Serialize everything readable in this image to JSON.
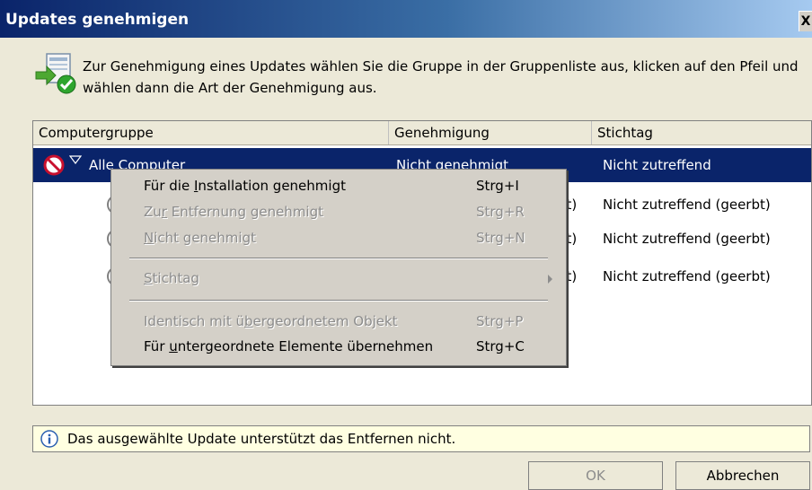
{
  "window": {
    "title": "Updates genehmigen",
    "close_label": "X"
  },
  "instruction": "Zur Genehmigung eines Updates wählen Sie die Gruppe in der Gruppenliste aus, klicken auf den Pfeil und wählen dann die Art der Genehmigung aus.",
  "table": {
    "columns": [
      "Computergruppe",
      "Genehmigung",
      "Stichtag"
    ],
    "rows": [
      {
        "group": "Alle Computer",
        "approval": "Nicht genehmigt",
        "deadline": "Nicht zutreffend",
        "selected": true
      },
      {
        "group": "",
        "approval_suffix": "bt)",
        "deadline": "Nicht zutreffend (geerbt)"
      },
      {
        "group": "",
        "approval_suffix": "bt)",
        "deadline": "Nicht zutreffend (geerbt)"
      },
      {
        "group": "",
        "approval_suffix": "bt)",
        "deadline": "Nicht zutreffend (geerbt)"
      }
    ]
  },
  "context_menu": {
    "items": [
      {
        "pre": "Für die ",
        "u": "I",
        "post": "nstallation genehmigt",
        "shortcut": "Strg+I",
        "enabled": true
      },
      {
        "pre": "Zu",
        "u": "r",
        "post": " Entfernung genehmigt",
        "shortcut": "Strg+R",
        "enabled": false
      },
      {
        "pre": "",
        "u": "N",
        "post": "icht genehmigt",
        "shortcut": "Strg+N",
        "enabled": false
      },
      {
        "pre": "",
        "u": "S",
        "post": "tichtag",
        "shortcut": "",
        "enabled": false
      },
      {
        "pre": "Identisch mit ü",
        "u": "b",
        "post": "ergeordnetem Objekt",
        "shortcut": "Strg+P",
        "enabled": false
      },
      {
        "pre": "Für ",
        "u": "u",
        "post": "ntergeordnete Elemente übernehmen",
        "shortcut": "Strg+C",
        "enabled": true
      }
    ]
  },
  "info_bar": {
    "text": "Das ausgewählte Update unterstützt das Entfernen nicht."
  },
  "buttons": {
    "ok": "OK",
    "cancel": "Abbrechen"
  },
  "colors": {
    "selection": "#0a246a",
    "dialog_bg": "#ece9d8",
    "menu_bg": "#d4d0c8",
    "info_bg": "#ffffe1"
  },
  "icons": {
    "header": "approval-check-icon",
    "status": "not-approved-icon",
    "info": "info-icon",
    "arrow": "dropdown-arrow-icon"
  }
}
